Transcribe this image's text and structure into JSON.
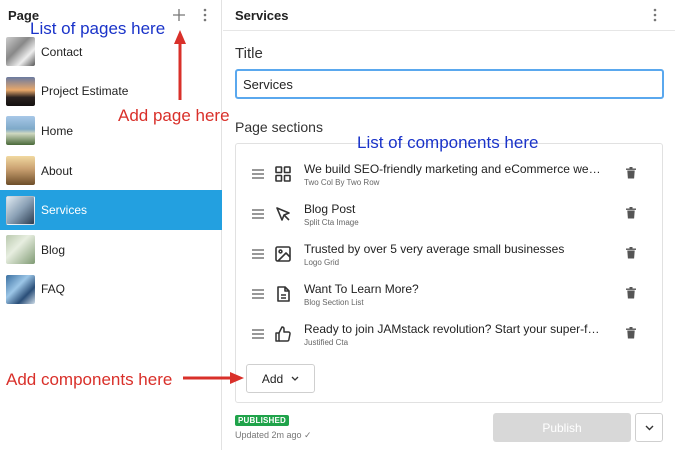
{
  "sidebar": {
    "title": "Page",
    "pages": [
      {
        "label": "Contact"
      },
      {
        "label": "Project Estimate"
      },
      {
        "label": "Home"
      },
      {
        "label": "About"
      },
      {
        "label": "Services",
        "active": true
      },
      {
        "label": "Blog"
      },
      {
        "label": "FAQ"
      }
    ]
  },
  "main": {
    "title": "Services",
    "title_field_label": "Title",
    "title_value": "Services",
    "sections_label": "Page sections",
    "components": [
      {
        "title": "We build SEO-friendly marketing and eCommerce websi...",
        "subtitle": "Two Col By Two Row",
        "icon": "grid-icon"
      },
      {
        "title": "Blog Post",
        "subtitle": "Split Cta Image",
        "icon": "cursor-icon"
      },
      {
        "title": "Trusted by over 5 very average small businesses",
        "subtitle": "Logo Grid",
        "icon": "image-icon"
      },
      {
        "title": "Want To Learn More?",
        "subtitle": "Blog Section List",
        "icon": "document-icon"
      },
      {
        "title": "Ready to join JAMstack revolution? Start your super-fast...",
        "subtitle": "Justified Cta",
        "icon": "thumbs-up-icon"
      }
    ],
    "add_label": "Add",
    "status_badge": "PUBLISHED",
    "updated_text": "Updated 2m ago ✓",
    "publish_label": "Publish"
  },
  "annotations": {
    "list_pages": "List of pages here",
    "add_page": "Add page here",
    "list_components": "List of components here",
    "add_components": "Add components here"
  },
  "colors": {
    "active_item": "#23a0e0",
    "input_focus": "#5aa8ee",
    "published": "#1fa34a",
    "annotation_blue": "#1a33c9",
    "annotation_red": "#d9302a"
  }
}
